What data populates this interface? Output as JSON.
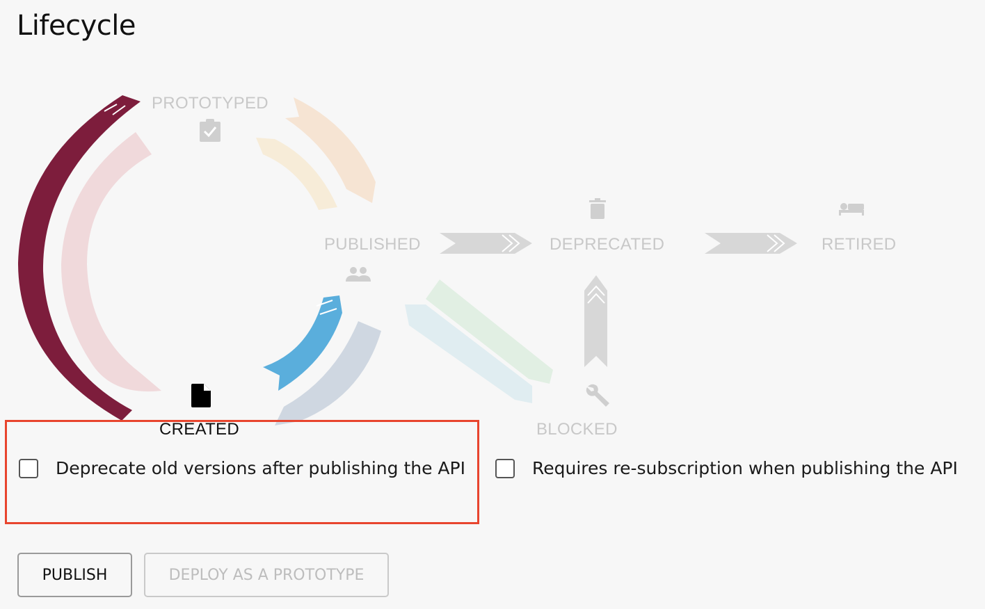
{
  "title": "Lifecycle",
  "states": {
    "prototyped": "PROTOTYPED",
    "published": "PUBLISHED",
    "deprecated": "DEPRECATED",
    "retired": "RETIRED",
    "created": "CREATED",
    "blocked": "BLOCKED"
  },
  "current_state": "CREATED",
  "icons": {
    "prototyped": "clipboard-check-icon",
    "published": "people-icon",
    "deprecated": "trash-icon",
    "retired": "bed-icon",
    "created": "document-icon",
    "blocked": "wrench-icon"
  },
  "options": {
    "deprecate_old_versions": {
      "label": "Deprecate old versions after publishing the API",
      "checked": false
    },
    "requires_resubscription": {
      "label": "Requires re-subscription when publishing the API",
      "checked": false
    }
  },
  "buttons": {
    "publish": "PUBLISH",
    "deploy_prototype": "DEPLOY AS A PROTOTYPE"
  },
  "colors": {
    "created_to_prototyped": "#7d1d3c",
    "created_to_published": "#5aaedc",
    "highlight": "#e8452e"
  }
}
